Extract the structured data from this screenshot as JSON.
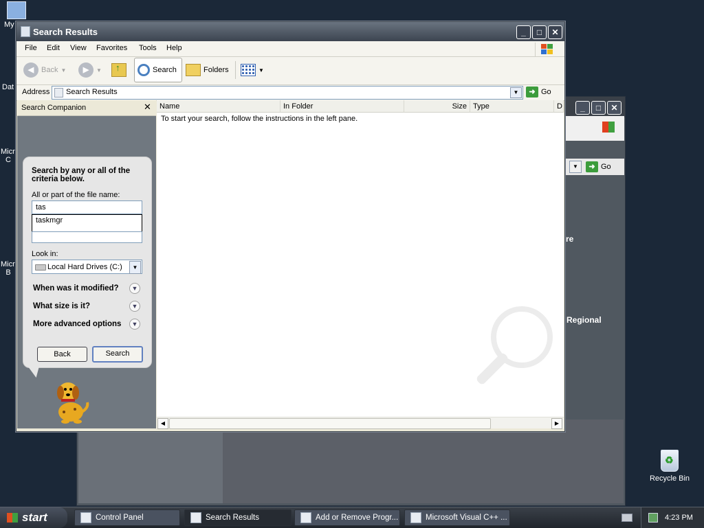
{
  "desktop": {
    "icons": [
      {
        "label": "My",
        "name": "my-computer"
      },
      {
        "label": "Dat",
        "name": "data"
      },
      {
        "label": "Micro\nC",
        "name": "microsoft-1"
      },
      {
        "label": "Micro\nB",
        "name": "microsoft-2"
      }
    ],
    "recycle_bin": "Recycle Bin"
  },
  "background_window": {
    "go_label": "Go",
    "text_re": "re",
    "text_regional": "Regional"
  },
  "window": {
    "title": "Search Results",
    "menu": [
      "File",
      "Edit",
      "View",
      "Favorites",
      "Tools",
      "Help"
    ],
    "toolbar": {
      "back": "Back",
      "search": "Search",
      "folders": "Folders"
    },
    "address": {
      "label": "Address",
      "value": "Search Results",
      "go": "Go"
    }
  },
  "search_companion": {
    "title": "Search Companion",
    "heading": "Search by any or all of the criteria below.",
    "filename_label": "All or part of the file name:",
    "filename_value": "tas",
    "autocomplete": "taskmgr",
    "lookin_label": "Look in:",
    "lookin_value": "Local Hard Drives (C:)",
    "options": [
      "When was it modified?",
      "What size is it?",
      "More advanced options"
    ],
    "back_button": "Back",
    "search_button": "Search"
  },
  "results": {
    "columns": [
      "Name",
      "In Folder",
      "Size",
      "Type",
      "D"
    ],
    "message": "To start your search, follow the instructions in the left pane."
  },
  "taskbar": {
    "start": "start",
    "tasks": [
      {
        "label": "Control Panel",
        "active": false
      },
      {
        "label": "Search Results",
        "active": true
      },
      {
        "label": "Add or Remove Progr...",
        "active": false
      },
      {
        "label": "Microsoft Visual C++ ...",
        "active": false
      }
    ],
    "clock": "4:23 PM"
  }
}
